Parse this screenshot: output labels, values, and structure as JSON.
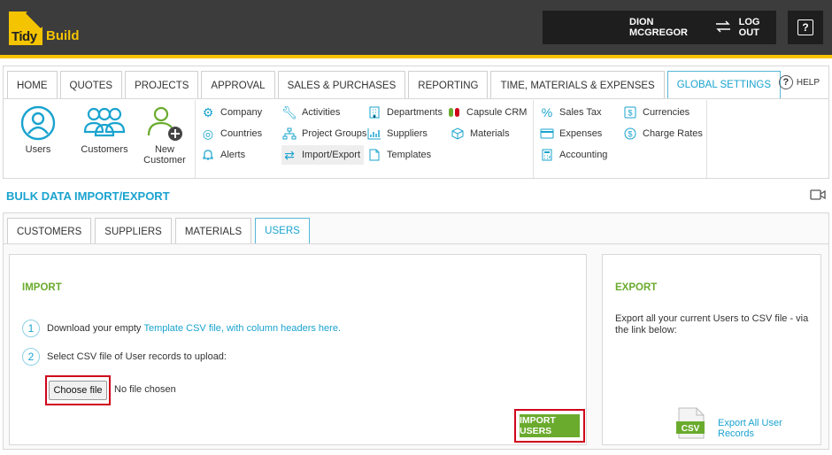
{
  "header": {
    "logo_word1": "Tidy",
    "logo_word2": "Build",
    "user_name": "DION MCGREGOR",
    "logout_label": "LOG OUT",
    "help_glyph": "?"
  },
  "nav": {
    "tabs": [
      {
        "label": "HOME"
      },
      {
        "label": "QUOTES"
      },
      {
        "label": "PROJECTS"
      },
      {
        "label": "APPROVAL"
      },
      {
        "label": "SALES & PURCHASES"
      },
      {
        "label": "REPORTING"
      },
      {
        "label": "TIME, MATERIALS & EXPENSES"
      },
      {
        "label": "GLOBAL SETTINGS"
      }
    ],
    "active_tab": "GLOBAL SETTINGS",
    "help_label": "HELP"
  },
  "big_icons": [
    {
      "label": "Users",
      "icon": "user-circle-icon"
    },
    {
      "label": "Customers",
      "icon": "group-icon"
    },
    {
      "label_line1": "New",
      "label_line2": "Customer",
      "icon": "user-add-icon"
    }
  ],
  "submenu": {
    "col1": [
      {
        "label": "Company",
        "icon": "gears-icon"
      },
      {
        "label": "Countries",
        "icon": "globe-icon"
      },
      {
        "label": "Alerts",
        "icon": "bell-icon"
      }
    ],
    "col2": [
      {
        "label": "Activities",
        "icon": "wrench-icon"
      },
      {
        "label": "Project Groups",
        "icon": "sitemap-icon"
      },
      {
        "label": "Import/Export",
        "icon": "exchange-icon"
      }
    ],
    "col3": [
      {
        "label": "Departments",
        "icon": "building-icon"
      },
      {
        "label": "Suppliers",
        "icon": "chart-icon"
      },
      {
        "label": "Templates",
        "icon": "document-icon"
      }
    ],
    "col4": [
      {
        "label": "Capsule CRM",
        "icon": "capsule-icon"
      },
      {
        "label": "Materials",
        "icon": "cube-icon"
      }
    ],
    "col5": [
      {
        "label": "Sales Tax",
        "icon": "percent-icon"
      },
      {
        "label": "Expenses",
        "icon": "card-icon"
      },
      {
        "label": "Accounting",
        "icon": "calculator-icon"
      }
    ],
    "col6": [
      {
        "label": "Currencies",
        "icon": "dollar-square-icon"
      },
      {
        "label": "Charge Rates",
        "icon": "dollar-circle-icon"
      }
    ]
  },
  "page": {
    "title": "BULK DATA IMPORT/EXPORT"
  },
  "subtabs": [
    {
      "label": "CUSTOMERS"
    },
    {
      "label": "SUPPLIERS"
    },
    {
      "label": "MATERIALS"
    },
    {
      "label": "USERS"
    }
  ],
  "import": {
    "title": "IMPORT",
    "step1_num": "1",
    "step1_text": "Download your empty ",
    "step1_link": "Template CSV file, with column headers here",
    "step1_end": ".",
    "step2_num": "2",
    "step2_text": "Select CSV file of User records to upload:",
    "file_button": "Choose file",
    "file_status": "No file chosen",
    "import_button": "IMPORT USERS"
  },
  "export": {
    "title": "EXPORT",
    "description": "Export all your current Users to CSV file - via the link below:",
    "csv_label": "CSV",
    "link": "Export All User Records"
  },
  "colors": {
    "accent": "#1aa3cf",
    "green": "#6aab2e",
    "brand_yellow": "#f5c400",
    "highlight_red": "#d0021b"
  }
}
